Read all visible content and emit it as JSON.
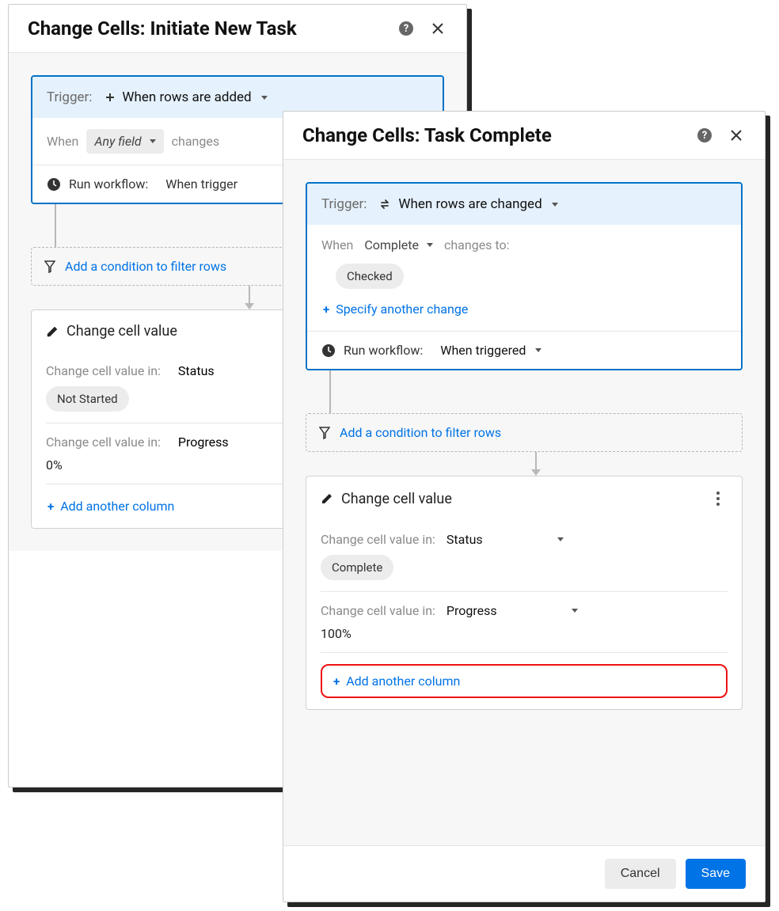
{
  "back": {
    "title": "Change Cells: Initiate New Task",
    "trigger_label": "Trigger:",
    "trigger_value": "When rows are added",
    "when_label": "When",
    "when_field": "Any field",
    "changes_label": "changes",
    "run_label": "Run workflow:",
    "run_value": "When trigger",
    "condition_link": "Add a condition to filter rows",
    "action_title": "Change cell value",
    "col1_label": "Change cell value in:",
    "col1_field": "Status",
    "col1_value": "Not Started",
    "col2_label": "Change cell value in:",
    "col2_field": "Progress",
    "col2_value": "0%",
    "add_col": "Add another column"
  },
  "front": {
    "title": "Change Cells: Task Complete",
    "trigger_label": "Trigger:",
    "trigger_value": "When rows are changed",
    "when_label": "When",
    "when_field": "Complete",
    "changes_to_label": "changes to:",
    "changes_to_value": "Checked",
    "specify_another": "Specify another change",
    "run_label": "Run workflow:",
    "run_value": "When triggered",
    "condition_link": "Add a condition to filter rows",
    "action_title": "Change cell value",
    "col1_label": "Change cell value in:",
    "col1_field": "Status",
    "col1_value": "Complete",
    "col2_label": "Change cell value in:",
    "col2_field": "Progress",
    "col2_value": "100%",
    "add_col": "Add another column",
    "cancel": "Cancel",
    "save": "Save"
  }
}
